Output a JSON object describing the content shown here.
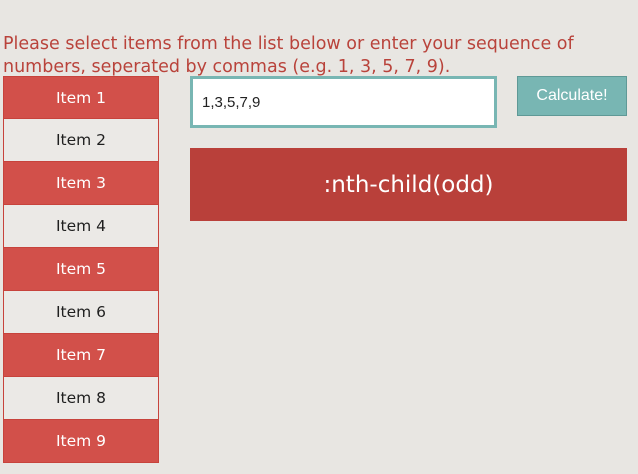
{
  "instructions": "Please select items from the list below or enter your sequence of numbers, seperated by commas (e.g. 1, 3, 5, 7, 9).",
  "items": [
    {
      "label": "Item 1",
      "selected": true
    },
    {
      "label": "Item 2",
      "selected": false
    },
    {
      "label": "Item 3",
      "selected": true
    },
    {
      "label": "Item 4",
      "selected": false
    },
    {
      "label": "Item 5",
      "selected": true
    },
    {
      "label": "Item 6",
      "selected": false
    },
    {
      "label": "Item 7",
      "selected": true
    },
    {
      "label": "Item 8",
      "selected": false
    },
    {
      "label": "Item 9",
      "selected": true
    }
  ],
  "sequence_input": {
    "value": "1,3,5,7,9"
  },
  "calculate_button": {
    "label": "Calculate!"
  },
  "result": {
    "text": ":nth-child(odd)"
  },
  "colors": {
    "selected_item": "#d2504a",
    "unselected_item": "#ebe9e6",
    "accent_teal": "#78b6b3",
    "result_bg": "#b9403a",
    "instruction_text": "#b9433b",
    "page_bg": "#e8e6e2"
  }
}
